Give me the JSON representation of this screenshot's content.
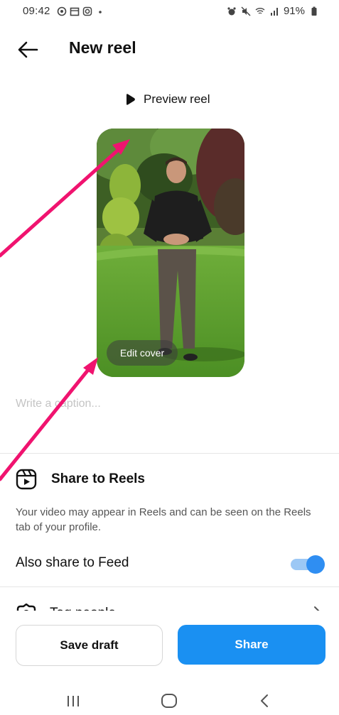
{
  "status_bar": {
    "time": "09:42",
    "battery": "91%"
  },
  "header": {
    "title": "New reel",
    "back_icon": "arrow-left-icon"
  },
  "preview": {
    "label": "Preview reel",
    "icon": "play-icon"
  },
  "cover": {
    "edit_label": "Edit cover"
  },
  "caption": {
    "placeholder": "Write a caption..."
  },
  "share_to_reels": {
    "title": "Share to Reels",
    "icon": "reels-icon",
    "description": "Your video may appear in Reels and can be seen on the Reels tab of your profile."
  },
  "feed": {
    "label": "Also share to Feed",
    "enabled": true
  },
  "tag_people": {
    "label": "Tag people",
    "icon": "tag-person-icon"
  },
  "actions": {
    "save_draft": "Save draft",
    "share": "Share"
  },
  "colors": {
    "accent": "#1a90f2",
    "annotation_arrow": "#f0136f"
  }
}
